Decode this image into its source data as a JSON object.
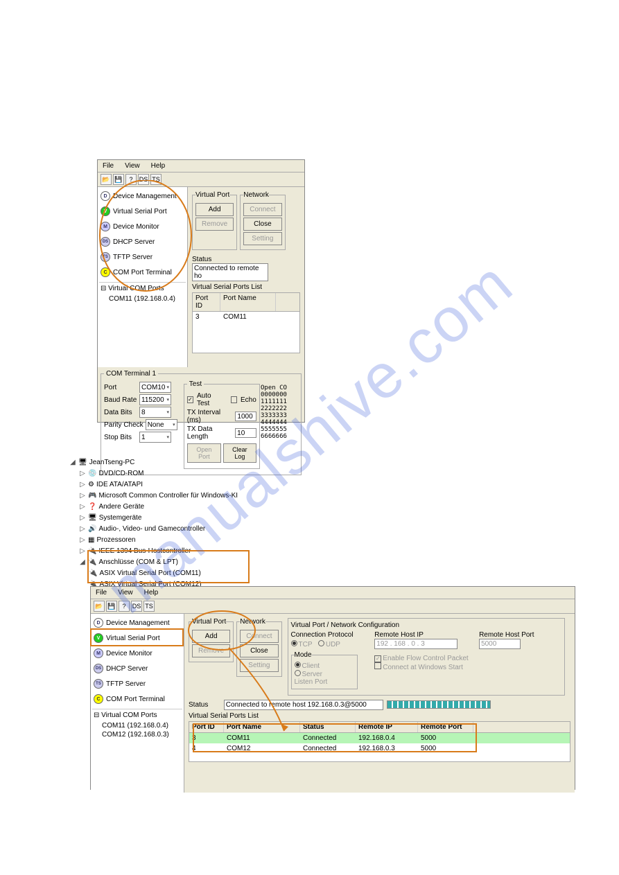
{
  "watermark": "manualshive.com",
  "app1": {
    "menu": {
      "file": "File",
      "view": "View",
      "help": "Help"
    },
    "toolbar_badges": [
      "DS",
      "TS"
    ],
    "nav": {
      "device_management": "Device Management",
      "virtual_serial_port": "Virtual Serial Port",
      "device_monitor": "Device Monitor",
      "dhcp_server": "DHCP Server",
      "tftp_server": "TFTP Server",
      "com_port_terminal": "COM Port Terminal"
    },
    "tree": {
      "header": "Virtual COM Ports",
      "item": "COM11 (192.168.0.4)"
    },
    "vport_group": "Virtual Port",
    "network_group": "Network",
    "btn_add": "Add",
    "btn_remove": "Remove",
    "btn_connect": "Connect",
    "btn_close": "Close",
    "btn_setting": "Setting",
    "status_label": "Status",
    "status_value": "Connected to remote ho",
    "list_title": "Virtual Serial Ports List",
    "col_portid": "Port ID",
    "col_portname": "Port Name",
    "row": {
      "port_id": "3",
      "port_name": "COM11"
    },
    "comterm": {
      "title": "COM Terminal 1",
      "port_lbl": "Port",
      "port_val": "COM10",
      "baud_lbl": "Baud Rate",
      "baud_val": "115200",
      "data_lbl": "Data Bits",
      "data_val": "8",
      "parity_lbl": "Parity Check",
      "parity_val": "None",
      "stop_lbl": "Stop Bits",
      "stop_val": "1",
      "test_lbl": "Test",
      "autotest_lbl": "Auto Test",
      "echo_lbl": "Echo",
      "txint_lbl": "TX Interval (ms)",
      "txint_val": "1000",
      "txlen_lbl": "TX Data Length",
      "txlen_val": "10",
      "openport": "Open Port",
      "clearlog": "Clear Log",
      "output": "Open CO\n0000000\n1111111\n2222222\n3333333\n4444444\n5555555\n6666666"
    }
  },
  "devmgr": {
    "root": "JeanTseng-PC",
    "items": [
      "DVD/CD-ROM",
      "IDE ATA/ATAPI",
      "Microsoft Common Controller für Windows-KI",
      "Andere Geräte",
      "Systemgeräte",
      "Audio-, Video- und Gamecontroller",
      "Prozessoren",
      "IEEE 1394 Bus-Hostcontroller",
      "Anschlüsse (COM & LPT)"
    ],
    "ports": [
      "ASIX Virtual Serial Port (COM11)",
      "ASIX Virtual Serial Port (COM12)"
    ]
  },
  "app2": {
    "menu": {
      "file": "File",
      "view": "View",
      "help": "Help"
    },
    "toolbar_badges": [
      "DS",
      "TS"
    ],
    "nav": {
      "device_management": "Device Management",
      "virtual_serial_port": "Virtual Serial Port",
      "device_monitor": "Device Monitor",
      "dhcp_server": "DHCP Server",
      "tftp_server": "TFTP Server",
      "com_port_terminal": "COM Port Terminal"
    },
    "tree": {
      "header": "Virtual COM Ports",
      "item1": "COM11 (192.168.0.4)",
      "item2": "COM12 (192.168.0.3)"
    },
    "vport_group": "Virtual Port",
    "network_group": "Network",
    "btn_add": "Add",
    "btn_remove": "Remove",
    "btn_connect": "Connect",
    "btn_close": "Close",
    "btn_setting": "Setting",
    "cfg_title": "Virtual Port / Network Configuration",
    "conn_proto": "Connection Protocol",
    "tcp": "TCP",
    "udp": "UDP",
    "mode": "Mode",
    "client": "Client",
    "server": "Server",
    "listen": "Listen Port",
    "remote_ip_lbl": "Remote Host IP",
    "remote_ip_val": "192 . 168 . 0 . 3",
    "remote_port_lbl": "Remote Host Port",
    "remote_port_val": "5000",
    "flow_ctrl": "Enable Flow Control Packet",
    "win_start": "Connect at Windows Start",
    "status_label": "Status",
    "status_value": "Connected to remote host 192.168.0.3@5000",
    "list_title": "Virtual Serial Ports List",
    "cols": {
      "pid": "Port ID",
      "pn": "Port Name",
      "st": "Status",
      "ip": "Remote IP",
      "rp": "Remote Port"
    },
    "rows": [
      {
        "pid": "3",
        "pn": "COM11",
        "st": "Connected",
        "ip": "192.168.0.4",
        "rp": "5000"
      },
      {
        "pid": "4",
        "pn": "COM12",
        "st": "Connected",
        "ip": "192.168.0.3",
        "rp": "5000"
      }
    ]
  }
}
